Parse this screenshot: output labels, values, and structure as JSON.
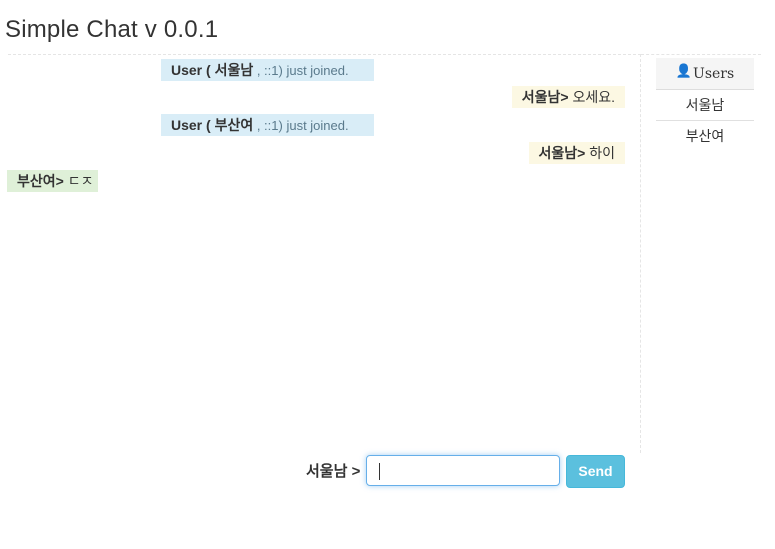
{
  "app": {
    "title": "Simple Chat v 0.0.1"
  },
  "messages": [
    {
      "kind": "system",
      "prefix": "User ( ",
      "name": "서울남",
      "suffix": " , ::1) just joined."
    },
    {
      "kind": "mine",
      "name": "서울남>",
      "text": " 오세요."
    },
    {
      "kind": "system",
      "prefix": "User ( ",
      "name": "부산여",
      "suffix": " , ::1) just joined."
    },
    {
      "kind": "mine",
      "name": "서울남>",
      "text": " 하이"
    },
    {
      "kind": "other",
      "name": "부산여>",
      "text": " ㄷㅈ"
    }
  ],
  "users": {
    "header": "Users",
    "icon": "user-icon",
    "list": [
      "서울남",
      "부산여"
    ]
  },
  "composer": {
    "label": "서울남 >",
    "input_value": "",
    "send_label": "Send"
  },
  "colors": {
    "system_bg": "#d9edf7",
    "mine_bg": "#fcf8e3",
    "other_bg": "#dff0d8",
    "send_bg": "#5bc0de"
  }
}
